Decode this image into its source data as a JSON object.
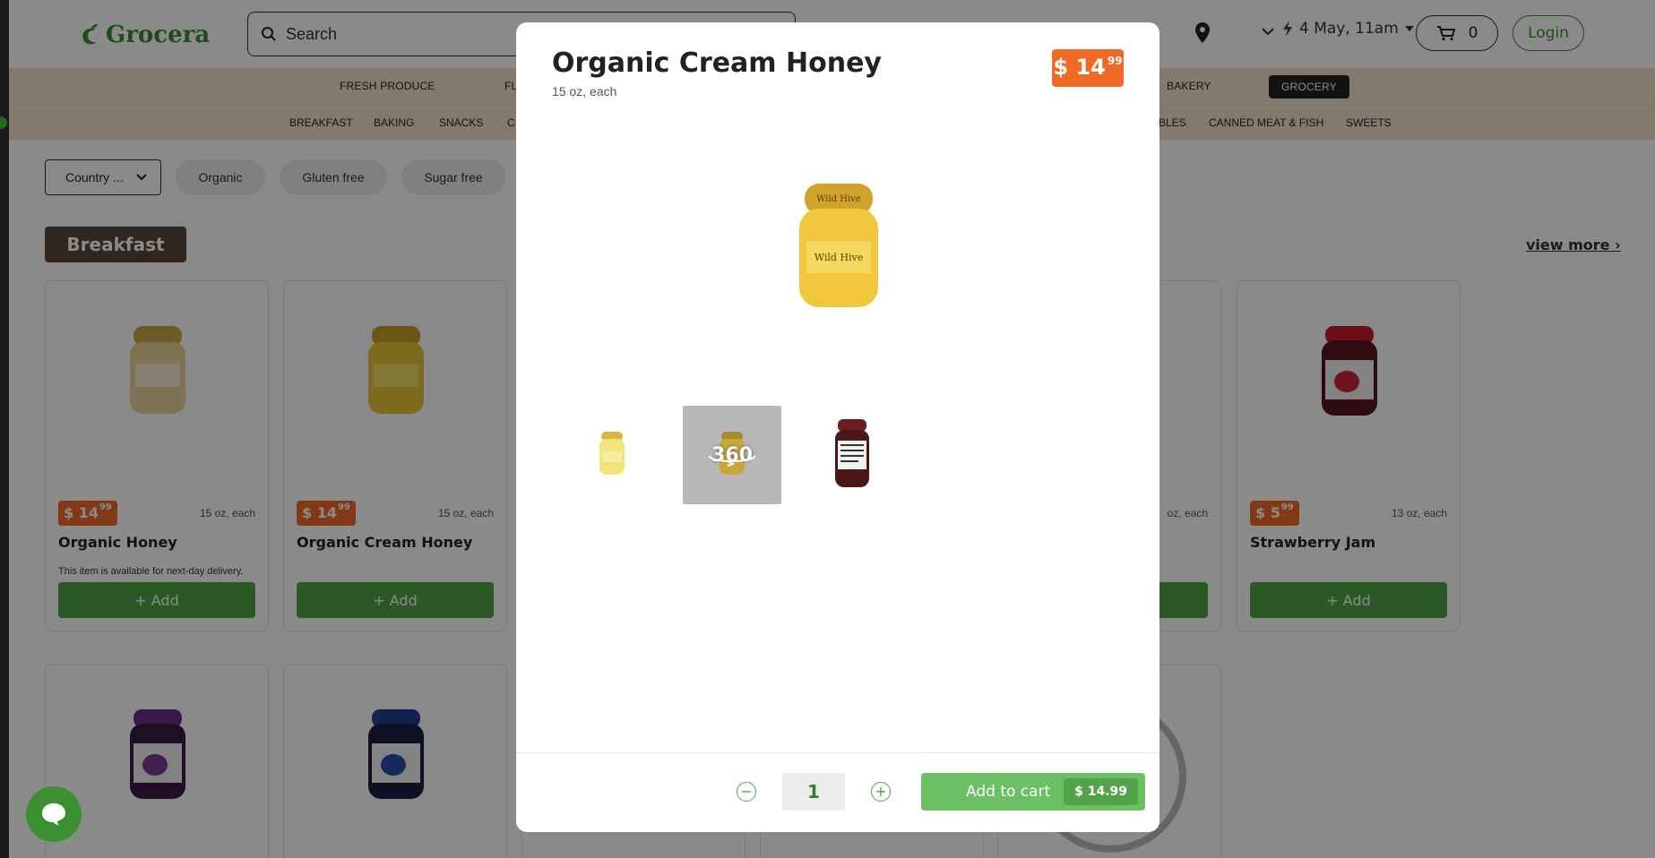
{
  "header": {
    "logo": "Grocera",
    "search_placeholder": "Search",
    "delivery": "4 May, 11am",
    "cart_count": "0",
    "login_label": "Login"
  },
  "categories": [
    "FRESH PRODUCE",
    "FL",
    "BAKERY",
    "GROCERY"
  ],
  "subcategories": [
    "BREAKFAST",
    "BAKING",
    "SNACKS",
    "C",
    "BLES",
    "CANNED MEAT & FISH",
    "SWEETS"
  ],
  "filters": {
    "country": "Country ...",
    "pills": [
      "Organic",
      "Gluten free",
      "Sugar free"
    ]
  },
  "section": {
    "title": "Breakfast",
    "view_more": "view more"
  },
  "products": [
    {
      "price_main": "$ 14",
      "price_cents": "99",
      "unit": "15 oz, each",
      "name": "Organic Honey",
      "note": "This item is available for next-day delivery.",
      "add_label": "+ Add"
    },
    {
      "price_main": "$ 14",
      "price_cents": "99",
      "unit": "15 oz, each",
      "name": "Organic Cream Honey",
      "note": "",
      "add_label": "+ Add"
    },
    {
      "price_main": "",
      "price_cents": "",
      "unit": "oz, each",
      "name": "",
      "note": "",
      "add_label": ""
    },
    {
      "price_main": "$ 5",
      "price_cents": "99",
      "unit": "13 oz, each",
      "name": "Strawberry Jam",
      "note": "",
      "add_label": "+ Add"
    }
  ],
  "modal": {
    "title": "Organic Cream Honey",
    "subtitle": "15 oz, each",
    "price_main": "$ 14",
    "price_cents": "99",
    "thumb_360_label": "360",
    "quantity": "1",
    "add_to_cart_label": "Add to cart",
    "add_to_cart_price": "$ 14.99"
  },
  "colors": {
    "brand_green": "#3a8f2f",
    "button_green": "#4ea547",
    "price_orange": "#f06a26",
    "nav_beige": "#f3e2c9"
  },
  "icons": [
    "search-icon",
    "map-pin-icon",
    "chevron-down-icon",
    "bolt-icon",
    "cart-icon",
    "minus-circle-icon",
    "plus-circle-icon",
    "chat-icon"
  ]
}
